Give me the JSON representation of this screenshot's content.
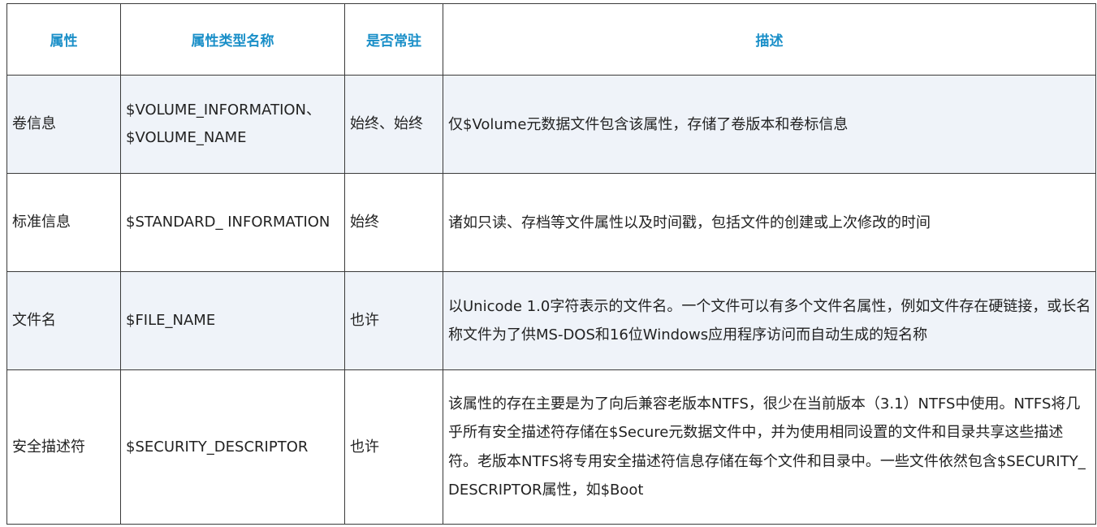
{
  "table": {
    "headers": [
      "属性",
      "属性类型名称",
      "是否常驻",
      "描述"
    ],
    "rows": [
      {
        "attribute": "卷信息",
        "type_name": "$VOLUME_INFORMATION、$VOLUME_NAME",
        "resident": "始终、始终",
        "description": "仅$Volume元数据文件包含该属性，存储了卷版本和卷标信息"
      },
      {
        "attribute": "标准信息",
        "type_name": "$STANDARD_ INFORMATION",
        "resident": "始终",
        "description": "诸如只读、存档等文件属性以及时间戳，包括文件的创建或上次修改的时间"
      },
      {
        "attribute": "文件名",
        "type_name": "$FILE_NAME",
        "resident": "也许",
        "description": "以Unicode 1.0字符表示的文件名。一个文件可以有多个文件名属性，例如文件存在硬链接，或长名称文件为了供MS-DOS和16位Windows应用程序访问而自动生成的短名称"
      },
      {
        "attribute": "安全描述符",
        "type_name": "$SECURITY_DESCRIPTOR",
        "resident": "也许",
        "description": "该属性的存在主要是为了向后兼容老版本NTFS，很少在当前版本（3.1）NTFS中使用。NTFS将几乎所有安全描述符存储在$Secure元数据文件中，并为使用相同设置的文件和目录共享这些描述符。老版本NTFS将专用安全描述符信息存储在每个文件和目录中。一些文件依然包含$SECURITY_ DESCRIPTOR属性，如$Boot"
      }
    ]
  }
}
